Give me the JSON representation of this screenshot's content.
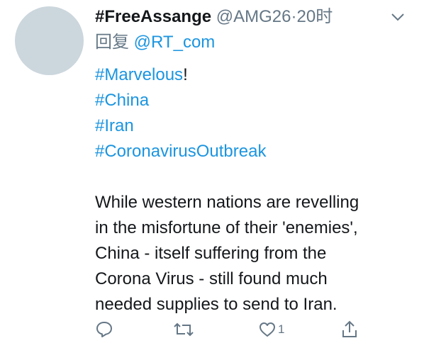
{
  "tweet": {
    "display_name": "#FreeAssange",
    "handle": "@AMG26",
    "separator": "·",
    "time": "20时",
    "reply_prefix": "回复",
    "reply_to": "@RT_com",
    "hashtags": [
      "#Marvelous",
      "#China",
      "#Iran",
      "#CoronavirusOutbreak"
    ],
    "exclamation": "!",
    "body_lines": [
      "While western nations are revelling",
      "in the misfortune of their 'enemies',",
      "China - itself suffering from the",
      "Corona Virus - still found much",
      "needed supplies to send to Iran."
    ]
  },
  "actions": {
    "reply_icon": "reply-icon",
    "retweet_icon": "retweet-icon",
    "like_icon": "heart-icon",
    "like_count": "1",
    "share_icon": "share-icon"
  },
  "colors": {
    "link": "#1b95e0",
    "muted": "#657786",
    "text": "#14171a",
    "avatar": "#ccd6dd"
  }
}
